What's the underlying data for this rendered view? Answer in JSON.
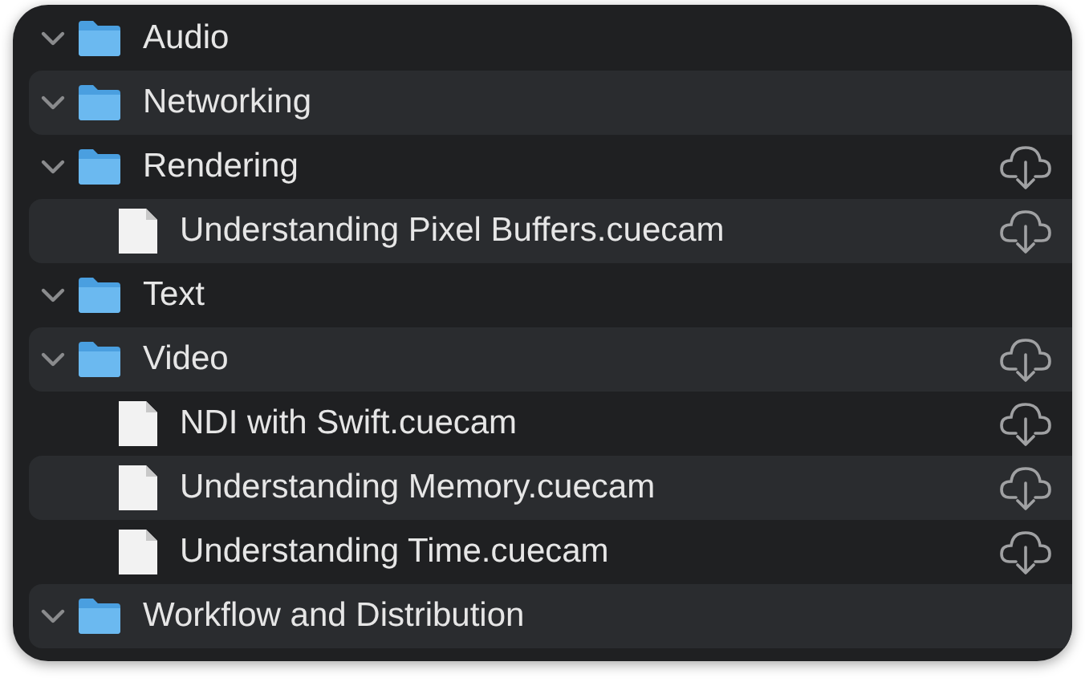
{
  "tree": [
    {
      "kind": "folder",
      "name": "Audio",
      "expanded": true,
      "cloud": false
    },
    {
      "kind": "folder",
      "name": "Networking",
      "expanded": true,
      "cloud": false
    },
    {
      "kind": "folder",
      "name": "Rendering",
      "expanded": true,
      "cloud": true,
      "children": [
        {
          "kind": "file",
          "name": "Understanding Pixel Buffers.cuecam",
          "cloud": true
        }
      ]
    },
    {
      "kind": "folder",
      "name": "Text",
      "expanded": true,
      "cloud": false
    },
    {
      "kind": "folder",
      "name": "Video",
      "expanded": true,
      "cloud": true,
      "children": [
        {
          "kind": "file",
          "name": "NDI with Swift.cuecam",
          "cloud": true
        },
        {
          "kind": "file",
          "name": "Understanding Memory.cuecam",
          "cloud": true
        },
        {
          "kind": "file",
          "name": "Understanding Time.cuecam",
          "cloud": true
        }
      ]
    },
    {
      "kind": "folder",
      "name": "Workflow and Distribution",
      "expanded": true,
      "cloud": false
    }
  ]
}
